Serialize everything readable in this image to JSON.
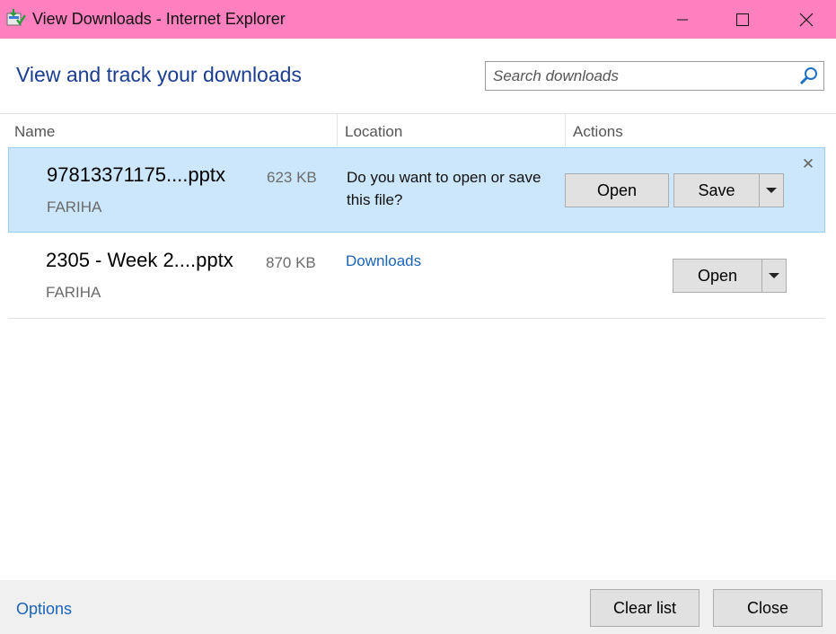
{
  "window": {
    "title": "View Downloads - Internet Explorer",
    "titlebar_color": "#ff80bf",
    "icons": [
      "app-icon",
      "minimize-icon",
      "maximize-icon",
      "close-icon"
    ]
  },
  "header": {
    "heading": "View and track your downloads",
    "search_placeholder": "Search downloads",
    "search_icon": "search-icon"
  },
  "columns": {
    "name": "Name",
    "location": "Location",
    "actions": "Actions"
  },
  "downloads": [
    {
      "name": "97813371175....pptx",
      "size": "623 KB",
      "source": "FARIHA",
      "location_prompt": "Do you want to open or save this file?",
      "open_label": "Open",
      "save_label": "Save",
      "selected": true,
      "highlight_color": "#cce7fb"
    },
    {
      "name": "2305 - Week 2....pptx",
      "size": "870 KB",
      "source": "FARIHA",
      "location": "Downloads",
      "open_label": "Open",
      "selected": false
    }
  ],
  "footer": {
    "options": "Options",
    "clear_list": "Clear list",
    "close": "Close"
  },
  "colors": {
    "heading": "#1b3d8f",
    "link": "#1a64b8"
  }
}
